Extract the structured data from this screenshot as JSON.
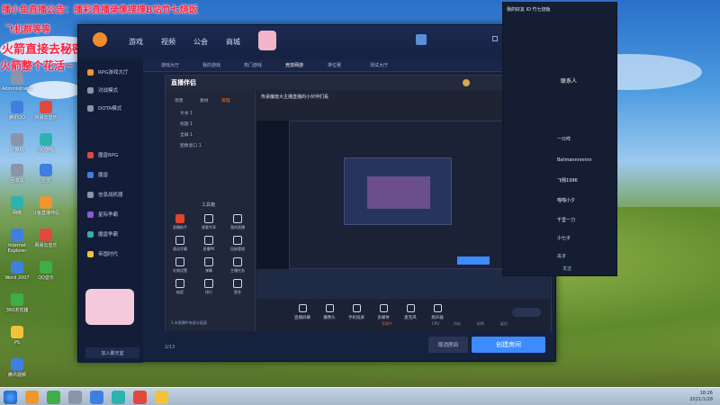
{
  "overlay": {
    "line1": "播小鱼直播公告：播彩直播录像搜搜B站竹七烧饭",
    "line2": "飞机群等等",
    "line3": "火箭直接去秘密公告嘿嘿 不懂你手",
    "line4": "火箭整个花活~"
  },
  "desktop_icons": [
    {
      "label": "Administrator"
    },
    {
      "label": "腾讯QQ"
    },
    {
      "label": "计算机"
    },
    {
      "label": "QQ游戏"
    },
    {
      "label": "网易云音乐"
    },
    {
      "label": "回收站"
    },
    {
      "label": "迅雷"
    },
    {
      "label": "网络"
    },
    {
      "label": "斗鱼直播伴侣"
    },
    {
      "label": "控制面板"
    },
    {
      "label": "谷歌浏览器"
    },
    {
      "label": "Internet Explorer"
    },
    {
      "label": "网易云音乐"
    },
    {
      "label": "Word 2007"
    },
    {
      "label": "QQ音乐"
    },
    {
      "label": "360浏览器"
    },
    {
      "label": "PS"
    },
    {
      "label": "腾讯视频"
    }
  ],
  "client": {
    "nav": [
      "游戏",
      "视频",
      "公会",
      "商城"
    ],
    "sub_nav": [
      "游戏大厅",
      "我的游戏",
      "热门游戏",
      "竞技网游",
      "排位赛",
      "测试大厅"
    ],
    "sidebar": [
      {
        "label": "RPG游戏大厅"
      },
      {
        "label": "对战模式"
      },
      {
        "label": "DOTA模式"
      },
      {
        "label": "魔兽RPG"
      },
      {
        "label": "魔兽"
      },
      {
        "label": "信息战机器"
      },
      {
        "label": "星际争霸"
      },
      {
        "label": "魔兽争霸"
      },
      {
        "label": "帝国时代"
      }
    ],
    "join_room": "加入聚天室",
    "page_indicator": "2/13"
  },
  "obs": {
    "title": "直播伴侣",
    "tabs": [
      "场景",
      "素材",
      "管理"
    ],
    "sources": [
      "文本 1",
      "标题 1",
      "全屏 1",
      "图像窗口 1"
    ],
    "tools_title": "工具箱",
    "tools": [
      {
        "label": "直播助手"
      },
      {
        "label": "观看专享"
      },
      {
        "label": "我的直播"
      },
      {
        "label": "滚动字幕"
      },
      {
        "label": "直播PK"
      },
      {
        "label": "回放管理"
      },
      {
        "label": "礼物设置"
      },
      {
        "label": "弹幕"
      },
      {
        "label": "主播任务"
      },
      {
        "label": "抽奖"
      },
      {
        "label": "排行"
      },
      {
        "label": "更多"
      }
    ],
    "stream_title": "传承魔兽大主播直播的小伙伴们看",
    "bottom_tools": [
      {
        "label": "直播屏幕"
      },
      {
        "label": "摄像头"
      },
      {
        "label": "手机投屏"
      },
      {
        "label": "多媒体"
      },
      {
        "label": "麦克风"
      },
      {
        "label": "扬声器"
      }
    ],
    "status": [
      "直播中",
      "CPU",
      "内存",
      "码率",
      "延迟"
    ],
    "notice": "1.本直播中有部分画面"
  },
  "actions": {
    "cancel": "取消房间",
    "create": "创建房间"
  },
  "chat": {
    "header": "我的好友 ID 竹七烧饭",
    "tab": "联系人",
    "lines": [
      "一只咩",
      "Batmannnnnnn",
      "飞翔1996",
      "喵喵小夕",
      "千里一刀",
      "小七子",
      "瓜子"
    ],
    "footer": "发送"
  },
  "taskbar": {
    "time": "18:26",
    "date": "2021/1/28"
  }
}
